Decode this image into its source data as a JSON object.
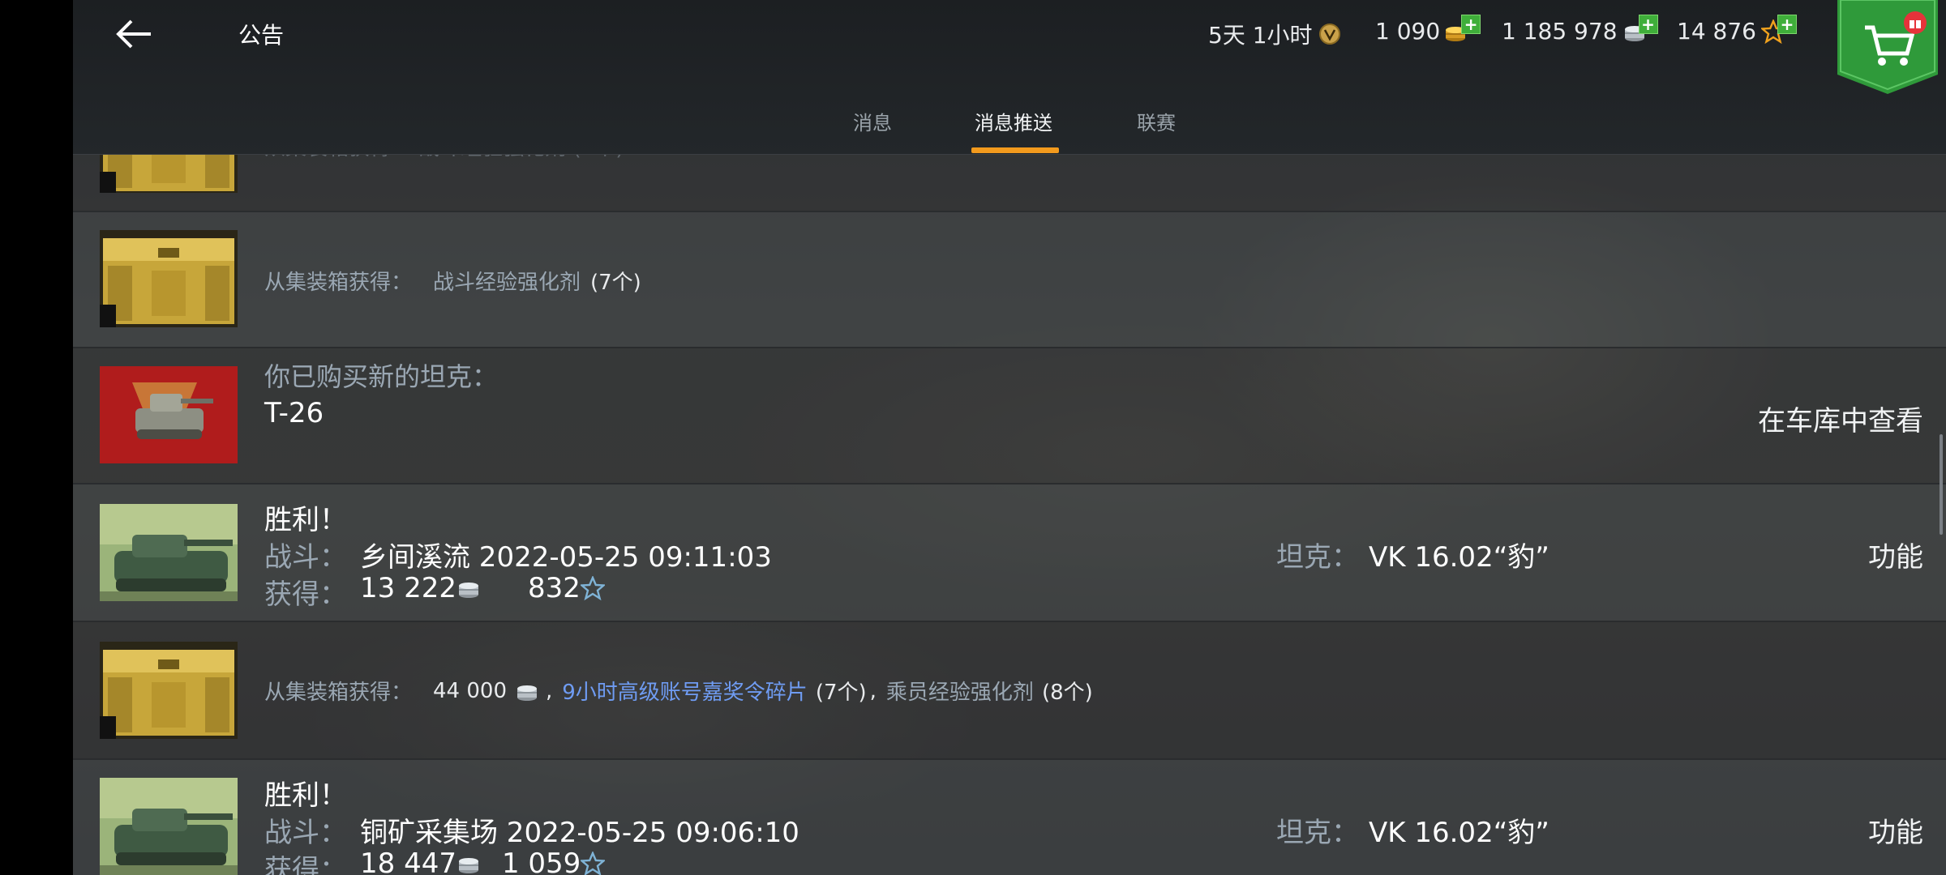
{
  "header": {
    "title": "公告",
    "premium_time": "5天 1小时",
    "gold": "1 090",
    "credits": "1 185 978",
    "free_xp": "14 876",
    "plus_label": "+"
  },
  "tabs": [
    {
      "label": "消息",
      "active": false
    },
    {
      "label": "消息推送",
      "active": true
    },
    {
      "label": "联赛",
      "active": false
    }
  ],
  "rows": {
    "partial": {
      "text": "从集装箱获得：  战斗经验强化剂  (7个)"
    },
    "container1": {
      "prefix": "从集装箱获得：",
      "item": "战斗经验强化剂",
      "count": "(7个)"
    },
    "purchase": {
      "line1": "你已购买新的坦克：",
      "tank": "T-26",
      "action": "在车库中查看"
    },
    "victory1": {
      "title": "胜利！",
      "battle_label": "战斗：",
      "battle_value": "乡间溪流 2022-05-25 09:11:03",
      "reward_label": "获得：",
      "credits": "13 222",
      "xp": "832",
      "tank_label": "坦克：",
      "tank_value": "VK 16.02“豹”",
      "action": "功能"
    },
    "container2": {
      "prefix": "从集装箱获得：",
      "credits": "44 000",
      "sep1": ",",
      "item1": "9小时高级账号嘉奖令碎片",
      "count1": "(7个)",
      "sep2": ",",
      "item2": "乘员经验强化剂",
      "count2": "(8个)"
    },
    "victory2": {
      "title": "胜利！",
      "battle_label": "战斗：",
      "battle_value": "铜矿采集场 2022-05-25 09:06:10",
      "reward_label": "获得：",
      "credits": "18 447",
      "xp": "1 059",
      "tank_label": "坦克：",
      "tank_value": "VK 16.02“豹”",
      "action": "功能"
    }
  },
  "icons": {
    "back": "back-arrow-icon",
    "premium": "premium-badge-icon",
    "gold": "gold-coins-icon",
    "credits": "silver-coins-icon",
    "free_xp": "star-icon",
    "shop": "shopping-cart-icon",
    "gift": "gift-icon"
  },
  "colors": {
    "accent_orange": "#f29a1d",
    "link_blue": "#6f9cf3",
    "muted_label": "#9aa7b3",
    "plus_green": "#3fae3a",
    "shop_green": "#2f9a3a"
  }
}
